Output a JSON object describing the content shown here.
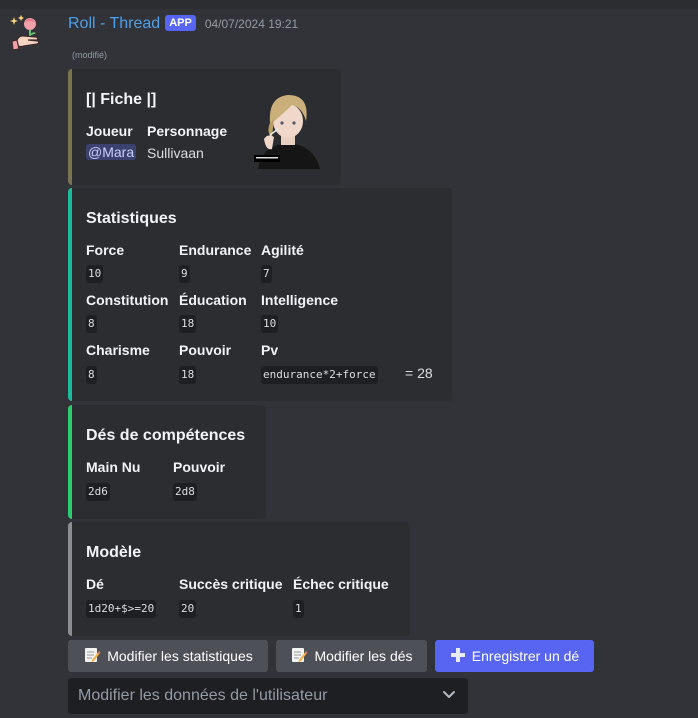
{
  "message": {
    "username": "Roll - Thread",
    "badge": "APP",
    "timestamp": "04/07/2024 19:21",
    "edited": "(modifié)"
  },
  "colors": {
    "embed1_border": "#7a7350",
    "embed2_border": "#1abc9c",
    "embed3_border": "#2ecc71",
    "embed4_border": "#8b8e93",
    "username": "#4f9ee8",
    "primary_button": "#5865f2"
  },
  "sheet": {
    "title": "[| Fiche |]",
    "fields": [
      {
        "name": "Joueur",
        "value": "@Mara"
      },
      {
        "name": "Personnage",
        "value": "Sullivaan"
      }
    ]
  },
  "stats": {
    "title": "Statistiques",
    "fields": [
      {
        "name": "Force",
        "value": "10"
      },
      {
        "name": "Endurance",
        "value": "9"
      },
      {
        "name": "Agilité",
        "value": "7"
      },
      {
        "name": "Constitution",
        "value": "8"
      },
      {
        "name": "Éducation",
        "value": "18"
      },
      {
        "name": "Intelligence",
        "value": "10"
      },
      {
        "name": "Charisme",
        "value": "8"
      },
      {
        "name": "Pouvoir",
        "value": "18"
      },
      {
        "name": "Pv",
        "value": "endurance*2+force",
        "result": "= 28"
      }
    ]
  },
  "skills": {
    "title": "Dés de compétences",
    "fields": [
      {
        "name": "Main Nu",
        "value": "2d6"
      },
      {
        "name": "Pouvoir",
        "value": "2d8"
      }
    ]
  },
  "model": {
    "title": "Modèle",
    "fields": [
      {
        "name": "Dé",
        "value": "1d20+$>=20"
      },
      {
        "name": "Succès critique",
        "value": "20"
      },
      {
        "name": "Échec critique",
        "value": "1"
      }
    ]
  },
  "buttons": [
    {
      "label": "Modifier les statistiques",
      "icon": "memo-icon"
    },
    {
      "label": "Modifier les dés",
      "icon": "memo-icon"
    },
    {
      "label": "Enregistrer un dé",
      "icon": "plus-icon"
    }
  ],
  "select": {
    "placeholder": "Modifier les données de l'utilisateur"
  }
}
